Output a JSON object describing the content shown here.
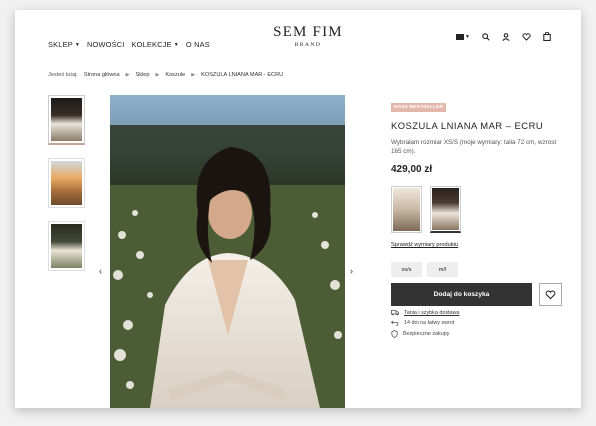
{
  "nav": {
    "items": [
      {
        "label": "SKLEP",
        "dropdown": true
      },
      {
        "label": "NOWOŚCI",
        "dropdown": false
      },
      {
        "label": "KOLEKCJE",
        "dropdown": true
      },
      {
        "label": "O NAS",
        "dropdown": false
      }
    ]
  },
  "logo": {
    "main": "SEM FIM",
    "sub": "BRAND"
  },
  "header_icons": [
    "flag-icon",
    "search-icon",
    "user-icon",
    "heart-icon",
    "bag-icon"
  ],
  "breadcrumb": {
    "prefix": "Jesteś tutaj:",
    "items": [
      "Strona główna",
      "Sklep",
      "Koszule",
      "KOSZULA LNIANA MAR - ECRU"
    ]
  },
  "product": {
    "badge": "NASZ BESTSELLER",
    "title": "KOSZULA LNIANA MAR – ECRU",
    "description": "Wybrałam rozmiar XS/S (moje wymiary: talia 72 cm, wzrost 165 cm).",
    "price": "429,00 zł",
    "size_guide_link": "Sprawdź wymiary produktu",
    "sizes": [
      "xs/s",
      "m/l"
    ],
    "add_to_cart": "Dodaj do koszyka",
    "features": [
      {
        "icon": "truck-icon",
        "text": "Tania i szybka dostawa",
        "underline": true
      },
      {
        "icon": "return-icon",
        "text": "14 dni na łatwy zwrot",
        "underline": false
      },
      {
        "icon": "shield-icon",
        "text": "Bezpieczne zakupy",
        "underline": false
      }
    ]
  },
  "colors": {
    "badge": "#e4b7ad",
    "button": "#333333",
    "accent": "#c9a39a"
  }
}
